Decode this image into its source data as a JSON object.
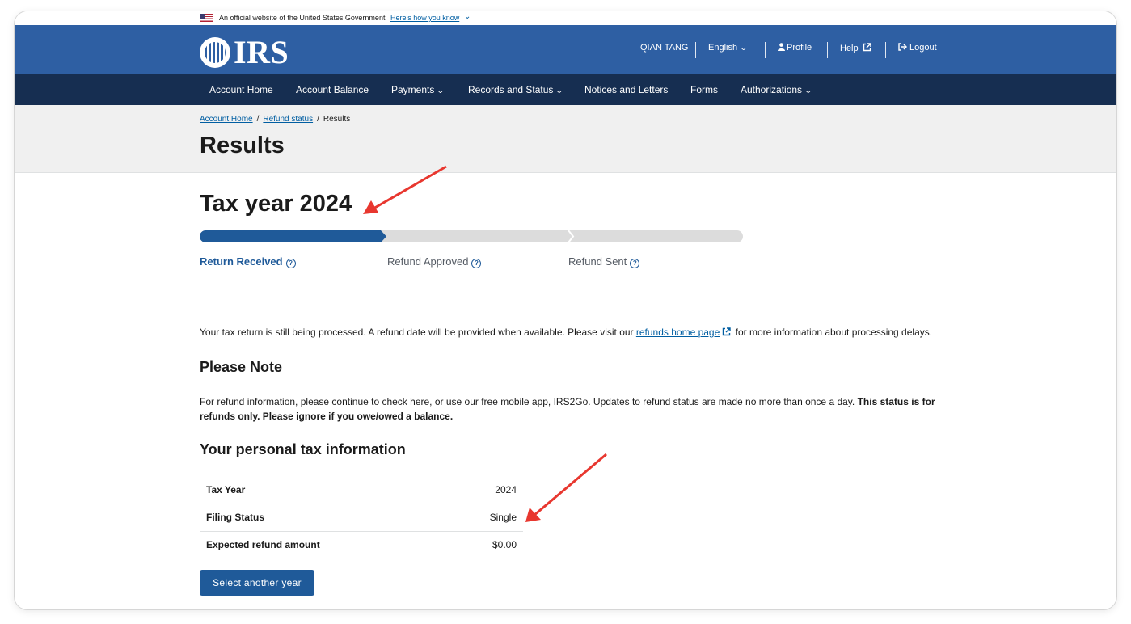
{
  "gov_banner": {
    "text": "An official website of the United States Government",
    "link": "Here's how you know"
  },
  "header": {
    "logo_text": "IRS",
    "user_name": "QIAN TANG",
    "language": "English",
    "profile": "Profile",
    "help": "Help",
    "logout": "Logout"
  },
  "nav": {
    "items": [
      "Account Home",
      "Account Balance",
      "Payments",
      "Records and Status",
      "Notices and Letters",
      "Forms",
      "Authorizations"
    ]
  },
  "breadcrumb": {
    "home": "Account Home",
    "refund_status": "Refund status",
    "current": "Results"
  },
  "page_title": "Results",
  "tax_year_heading": "Tax year 2024",
  "progress": {
    "steps": [
      "Return Received",
      "Refund Approved",
      "Refund Sent"
    ],
    "completed_steps": 1,
    "active_color": "#1f5a99",
    "inactive_color": "#dcdcdc"
  },
  "status_message": {
    "before_link": "Your tax return is still being processed. A refund date will be provided when available. Please visit our",
    "link": "refunds home page",
    "after_link": "for more information about processing delays."
  },
  "please_note": {
    "heading": "Please Note",
    "text": "For refund information, please continue to check here, or use our free mobile app, IRS2Go. Updates to refund status are made no more than once a day.",
    "bold_1": "This status is for",
    "bold_2": "refunds only. Please ignore if you owe/owed a balance."
  },
  "personal_info": {
    "heading": "Your personal tax information",
    "rows": [
      {
        "label": "Tax Year",
        "value": "2024"
      },
      {
        "label": "Filing Status",
        "value": "Single"
      },
      {
        "label": "Expected refund amount",
        "value": "$0.00"
      }
    ]
  },
  "select_year_button": "Select another year",
  "colors": {
    "header_blue": "#2e5fa3",
    "nav_navy": "#162e51",
    "annotation_red": "#e8372f"
  }
}
